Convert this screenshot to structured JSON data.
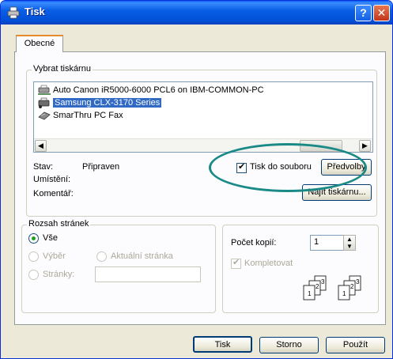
{
  "window": {
    "title": "Tisk",
    "help_button": "?",
    "close_button": "✕"
  },
  "tabs": [
    {
      "label": "Obecné"
    }
  ],
  "select_printer": {
    "legend": "Vybrat tiskárnu",
    "printers": [
      {
        "name": "Auto Canon iR5000-6000 PCL6 on IBM-COMMON-PC",
        "selected": false,
        "icon": "network-printer-icon"
      },
      {
        "name": "Samsung CLX-3170 Series",
        "selected": true,
        "icon": "printer-icon"
      },
      {
        "name": "SmarThru PC Fax",
        "selected": false,
        "icon": "fax-icon"
      }
    ],
    "status_label": "Stav:",
    "status_value": "Připraven",
    "location_label": "Umístění:",
    "location_value": "",
    "comment_label": "Komentář:",
    "comment_value": "",
    "print_to_file_label": "Tisk do souboru",
    "print_to_file_checked": true,
    "preferences_button": "Předvolby",
    "find_printer_button": "Najít tiskárnu..."
  },
  "page_range": {
    "legend": "Rozsah stránek",
    "all_label": "Vše",
    "selection_label": "Výběr",
    "current_page_label": "Aktuální stránka",
    "pages_label": "Stránky:",
    "pages_value": "",
    "selected": "all"
  },
  "copies": {
    "count_label": "Počet kopií:",
    "count_value": "1",
    "collate_label": "Kompletovat",
    "collate_checked": true
  },
  "footer": {
    "print_button": "Tisk",
    "cancel_button": "Storno",
    "apply_button": "Použít"
  },
  "colors": {
    "titlebar": "#0a5fe6",
    "selection": "#316ac5",
    "annotation_ellipse": "#1a8a86"
  }
}
